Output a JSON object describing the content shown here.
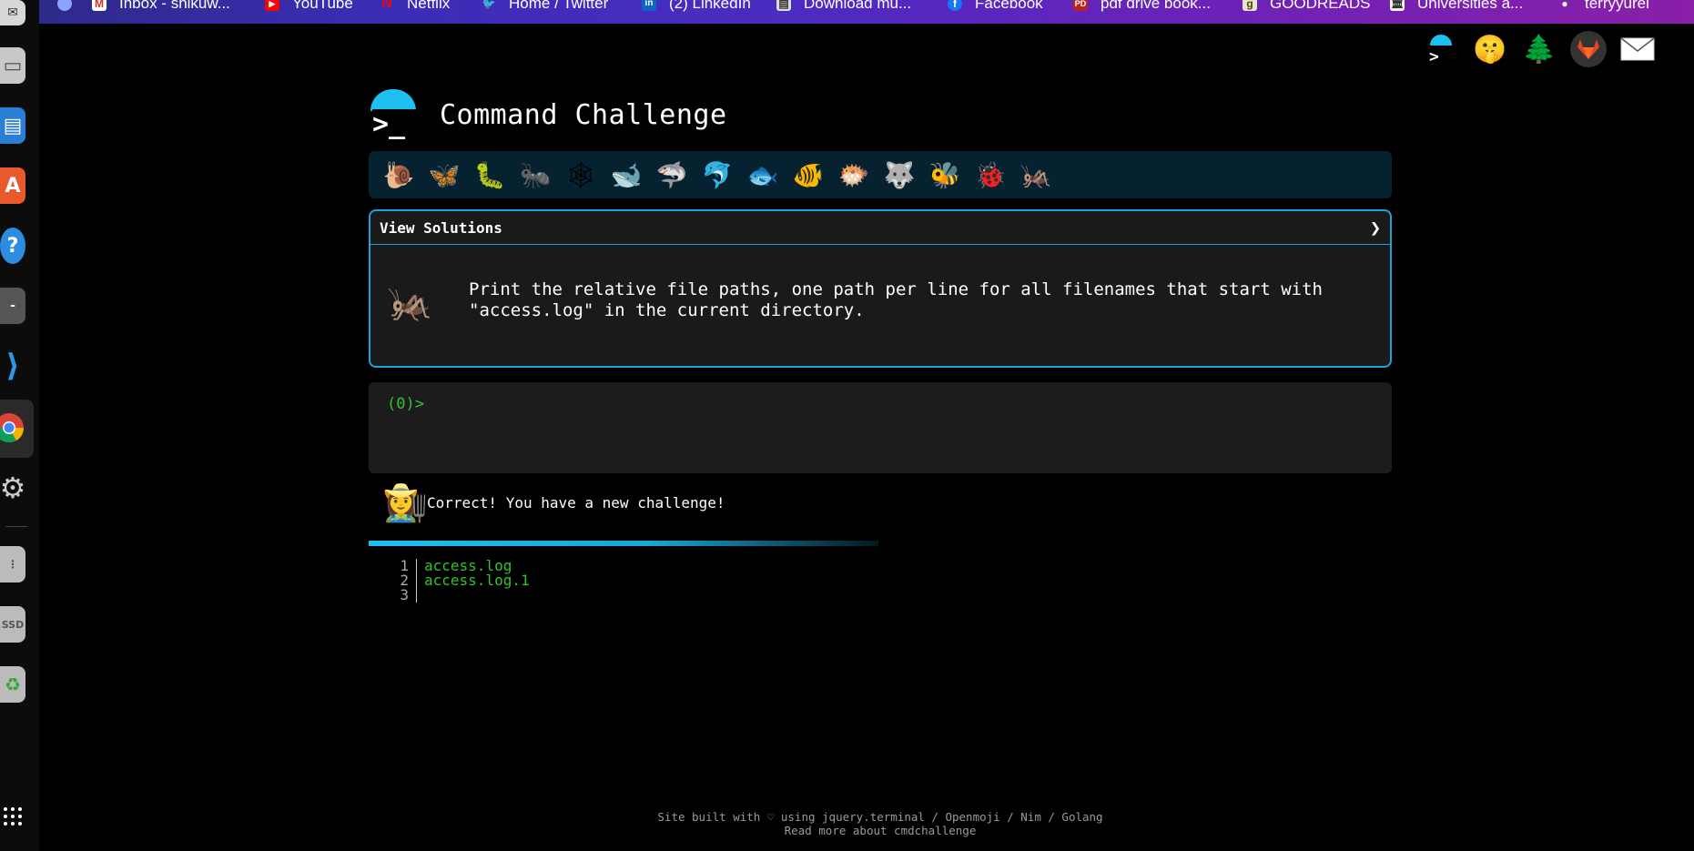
{
  "bookmarks": [
    {
      "label": "Inbox - shikuw...",
      "icon": "gmail-icon"
    },
    {
      "label": "YouTube",
      "icon": "youtube-icon"
    },
    {
      "label": "Netflix",
      "icon": "netflix-icon"
    },
    {
      "label": "Home / Twitter",
      "icon": "twitter-icon"
    },
    {
      "label": "(2) LinkedIn",
      "icon": "linkedin-icon"
    },
    {
      "label": "Download mu...",
      "icon": "printer-icon"
    },
    {
      "label": "Facebook",
      "icon": "facebook-icon"
    },
    {
      "label": "pdf drive book...",
      "icon": "pdfdrive-icon"
    },
    {
      "label": "GOODREADS",
      "icon": "goodreads-icon"
    },
    {
      "label": "Universities a...",
      "icon": "university-icon"
    },
    {
      "label": "terryyurei",
      "icon": "github-icon"
    }
  ],
  "page": {
    "title": "Command Challenge",
    "logo_prompt": ">_",
    "social": [
      "terminal-icon",
      "shush-face-icon",
      "tree-icon",
      "gitlab-icon",
      "mail-icon"
    ],
    "animals": [
      "🐌",
      "🦋",
      "🐛",
      "🐜",
      "🕸",
      "🐋",
      "🦈",
      "🐬",
      "🐟",
      "🐠",
      "🐡",
      "🐺",
      "🐝",
      "🐞",
      "🦗"
    ],
    "solutions_label": "View Solutions",
    "chevron": "❯",
    "challenge_animal": "🦗",
    "challenge_text": "Print the relative file paths, one path per line for all filenames that start with \"access.log\" in the current directory.",
    "prompt": "(0)>",
    "result_avatar": "👩‍🌾",
    "result_text": "Correct! You have a new challenge!",
    "output_lines": [
      {
        "n": "1",
        "text": "access.log"
      },
      {
        "n": "2",
        "text": "access.log.1"
      },
      {
        "n": "3",
        "text": ""
      }
    ],
    "footer_line1": "Site built with ♡ using jquery.terminal / Openmoji / Nim / Golang",
    "footer_line2": "Read more about cmdchallenge"
  },
  "colors": {
    "accent": "#1ec0f0",
    "terminal_green": "#2ec42e",
    "panel_bg": "#1a1a1a",
    "animal_bar_bg": "#062230"
  }
}
